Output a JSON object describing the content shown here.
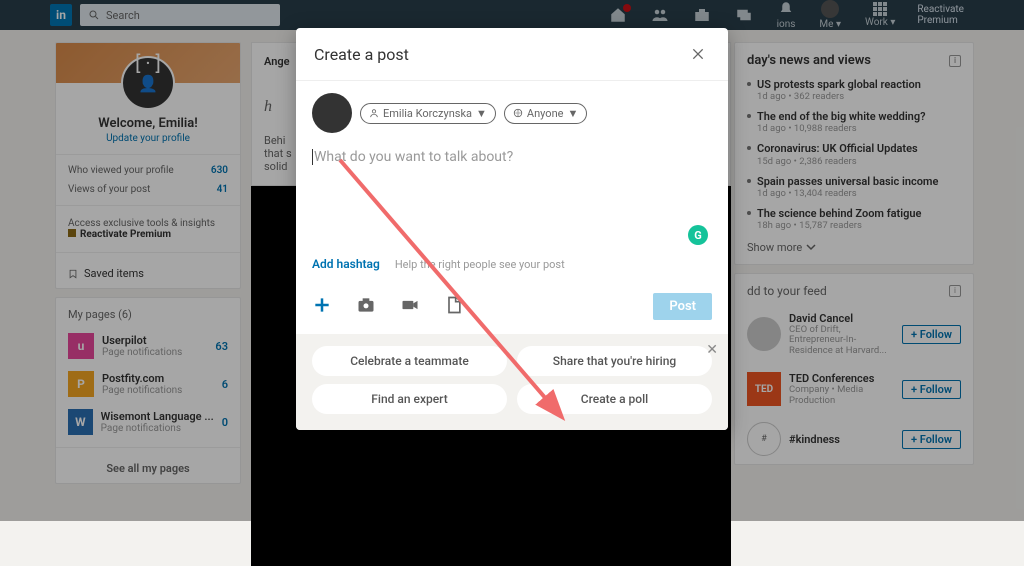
{
  "nav": {
    "search_placeholder": "Search",
    "me_label": "Me",
    "work_label": "Work",
    "reactivate_line1": "Reactivate",
    "reactivate_line2": "Premium",
    "ions_label": "ions"
  },
  "profile": {
    "welcome": "Welcome, Emilia!",
    "update": "Update your profile",
    "who_viewed": "Who viewed your profile",
    "who_viewed_count": "630",
    "post_views": "Views of your post",
    "post_views_count": "41",
    "premium_tagline": "Access exclusive tools & insights",
    "reactivate": "Reactivate Premium",
    "saved": "Saved items"
  },
  "mypages": {
    "heading": "My pages (6)",
    "items": [
      {
        "logo_bg": "#e8479b",
        "logo_text": "u",
        "name": "Userpilot",
        "sub": "Page notifications",
        "count": "63"
      },
      {
        "logo_bg": "#f5a623",
        "logo_text": "P",
        "name": "Postfity.com",
        "sub": "Page notifications",
        "count": "6"
      },
      {
        "logo_bg": "#2a6fb3",
        "logo_text": "W",
        "name": "Wisemont Language ...",
        "sub": "Page notifications",
        "count": "0"
      }
    ],
    "see_all": "See all my pages"
  },
  "feed": {
    "author": "Ange",
    "blurb1": "Behi",
    "blurb2": "that s",
    "blurb3": "solid"
  },
  "news": {
    "heading": "day's news and views",
    "items": [
      {
        "title": "US protests spark global reaction",
        "meta": "1d ago • 362 readers"
      },
      {
        "title": "The end of the big white wedding?",
        "meta": "1d ago • 10,988 readers"
      },
      {
        "title": "Coronavirus: UK Official Updates",
        "meta": "15d ago • 2,386 readers"
      },
      {
        "title": "Spain passes universal basic income",
        "meta": "1d ago • 13,404 readers"
      },
      {
        "title": "The science behind Zoom fatigue",
        "meta": "18h ago • 15,787 readers"
      }
    ],
    "show_more": "Show more"
  },
  "feed_recs": {
    "heading": "dd to your feed",
    "items": [
      {
        "name": "David Cancel",
        "sub": "CEO of Drift, Entrepreneur-In-Residence at Harvard..."
      },
      {
        "name": "TED Conferences",
        "sub": "Company • Media Production"
      },
      {
        "name": "#kindness",
        "sub": ""
      }
    ],
    "follow": "+ Follow"
  },
  "modal": {
    "title": "Create a post",
    "author_name": "Emilia Korczynska",
    "visibility": "Anyone",
    "placeholder": "What do you want to talk about?",
    "add_hashtag": "Add hashtag",
    "help_text": "Help the right people see your post",
    "post_button": "Post",
    "suggestions": [
      "Celebrate a teammate",
      "Share that you're hiring",
      "Find an expert",
      "Create a poll"
    ]
  }
}
